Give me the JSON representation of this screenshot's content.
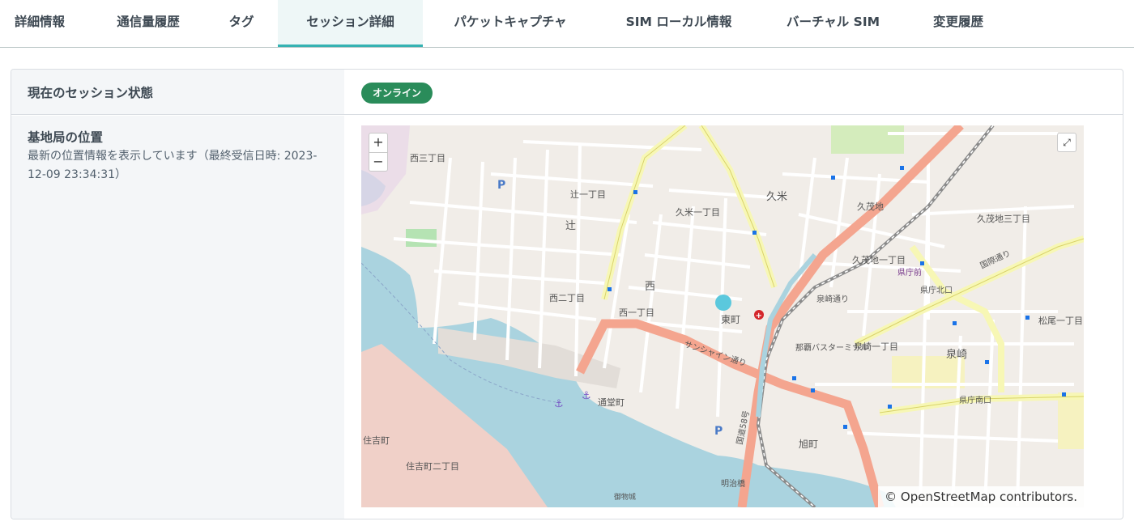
{
  "tabs": [
    {
      "label": "詳細情報"
    },
    {
      "label": "通信量履歴"
    },
    {
      "label": "タグ"
    },
    {
      "label": "セッション詳細"
    },
    {
      "label": "パケットキャプチャ"
    },
    {
      "label": "SIM ローカル情報"
    },
    {
      "label": "バーチャル SIM"
    },
    {
      "label": "変更履歴"
    }
  ],
  "session": {
    "status_label": "現在のセッション状態",
    "status_badge": "オンライン"
  },
  "location": {
    "title": "基地局の位置",
    "description": "最新の位置情報を表示しています（最終受信日時: 2023-12-09 23:34:31）"
  },
  "map": {
    "zoom_in": "+",
    "zoom_out": "−",
    "attribution_prefix": "© ",
    "attribution_link": "OpenStreetMap",
    "attribution_suffix": " contributors.",
    "labels": {
      "nishi3": "西三丁目",
      "tsuji1": "辻一丁目",
      "tsuji": "辻",
      "kume1": "久米一丁目",
      "kume": "久米",
      "kumodo": "久茂地",
      "kumodo1": "久茂地一丁目",
      "kumodo3": "久茂地三丁目",
      "prefectural_front": "県庁前",
      "nishi": "西",
      "nishi2": "西二丁目",
      "nishi1": "西一丁目",
      "higashimachi": "東町",
      "izumizaki": "泉崎",
      "izumizaki1": "泉崎一丁目",
      "asahimachi": "旭町",
      "sumiyoshi": "住吉町",
      "sumiyoshi2": "住吉町二丁目",
      "matsuo1": "松尾一丁目",
      "naha_bus_terminal": "那覇バスターミナル",
      "sunshine_street": "サンシャイン通り",
      "route58": "国道58号",
      "kokusai": "国際通り",
      "meijibashi": "明治橋",
      "tsudo": "通堂町",
      "ochinoshiro": "御物城",
      "kencho_kitaguchi": "県庁北口",
      "kencho_minamiguchi": "県庁南口",
      "izumizaki_street": "泉崎通り"
    }
  },
  "colors": {
    "tab_active_bg": "#eef7f7",
    "tab_active_border": "#35b2b2",
    "badge_online": "#2a8c5a",
    "map_water": "#aad3df",
    "map_primary_road": "#f4a58f",
    "map_secondary_road": "#f7f7b5",
    "map_marker": "#5bc8dd"
  },
  "icons": {
    "zoom_in": "plus-icon",
    "zoom_out": "minus-icon",
    "fullscreen": "expand-icon",
    "marker": "location-dot-icon"
  }
}
